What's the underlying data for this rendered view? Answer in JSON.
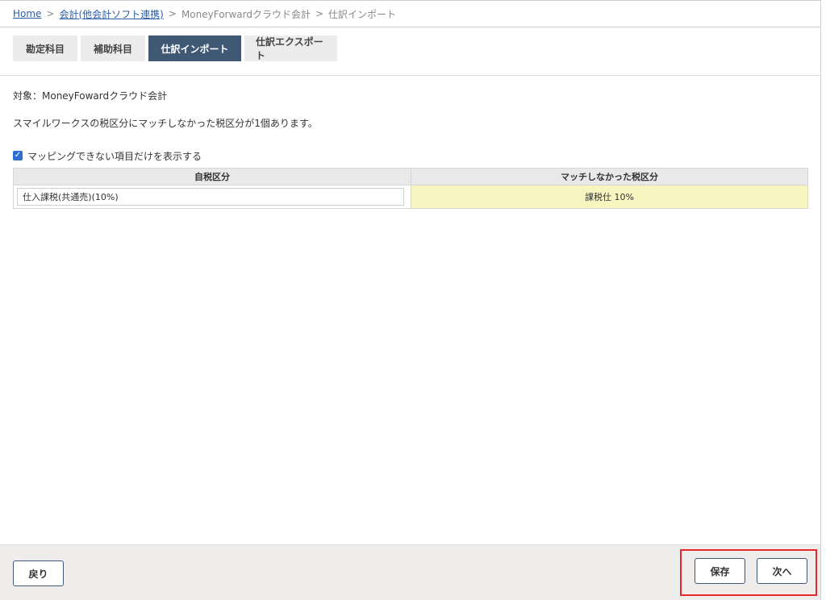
{
  "breadcrumb": {
    "home": "Home",
    "sep1": ">",
    "accounting": "会計(他会計ソフト連携)",
    "sep2": ">",
    "software": "MoneyForwardクラウド会計",
    "sep3": ">",
    "current": "仕訳インポート"
  },
  "tabs": [
    {
      "label": "勘定科目",
      "active": false
    },
    {
      "label": "補助科目",
      "active": false
    },
    {
      "label": "仕訳インポート",
      "active": true
    },
    {
      "label": "仕訳エクスポート",
      "active": false
    }
  ],
  "content": {
    "target_line": "対象：MoneyFowardクラウド会計",
    "message": "スマイルワークスの税区分にマッチしなかった税区分が1個あります。",
    "checkbox_label": "マッピングできない項目だけを表示する",
    "checkbox_checked": true
  },
  "table": {
    "headers": [
      "自税区分",
      "マッチしなかった税区分"
    ],
    "rows": [
      {
        "own_tax": "仕入課税(共通売)(10%)",
        "unmatched": "課税仕 10%"
      }
    ]
  },
  "footer": {
    "back_label": "戻り",
    "save_label": "保存",
    "next_label": "次へ"
  },
  "colors": {
    "active_tab": "#3f5873",
    "mismatch_bg": "#f8f5c0",
    "highlight_border": "#e8262b"
  }
}
